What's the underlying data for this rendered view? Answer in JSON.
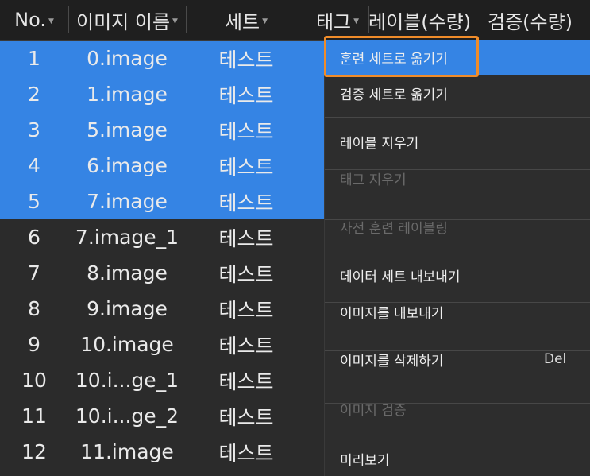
{
  "table": {
    "columns": [
      {
        "label": "No."
      },
      {
        "label": "이미지 이름"
      },
      {
        "label": "세트"
      },
      {
        "label": "태그"
      },
      {
        "label": "레이블(수량)"
      },
      {
        "label": "검증(수량)"
      }
    ],
    "rows": [
      {
        "no": "1",
        "name": "0.image",
        "set": "테스트",
        "selected": true
      },
      {
        "no": "2",
        "name": "1.image",
        "set": "테스트",
        "selected": true
      },
      {
        "no": "3",
        "name": "5.image",
        "set": "테스트",
        "selected": true
      },
      {
        "no": "4",
        "name": "6.image",
        "set": "테스트",
        "selected": true
      },
      {
        "no": "5",
        "name": "7.image",
        "set": "테스트",
        "selected": true
      },
      {
        "no": "6",
        "name": "7.image_1",
        "set": "테스트",
        "selected": false
      },
      {
        "no": "7",
        "name": "8.image",
        "set": "테스트",
        "selected": false
      },
      {
        "no": "8",
        "name": "9.image",
        "set": "테스트",
        "selected": false
      },
      {
        "no": "9",
        "name": "10.image",
        "set": "테스트",
        "selected": false
      },
      {
        "no": "10",
        "name": "10.i...ge_1",
        "set": "테스트",
        "selected": false
      },
      {
        "no": "11",
        "name": "10.i...ge_2",
        "set": "테스트",
        "selected": false
      },
      {
        "no": "12",
        "name": "11.image",
        "set": "테스트",
        "selected": false
      }
    ]
  },
  "context_menu": {
    "items": [
      {
        "label": "훈련 세트로 옮기기",
        "highlighted": true
      },
      {
        "label": "검증 세트로 옮기기"
      },
      {
        "label": "레이블 지우기"
      },
      {
        "label": "태그 지우기",
        "disabled": true
      },
      {
        "label": "사전 훈련 레이블링",
        "disabled": true
      },
      {
        "label": "데이터 세트 내보내기"
      },
      {
        "label": "이미지를 내보내기"
      },
      {
        "label": "이미지를 삭제하기",
        "shortcut": "Del"
      },
      {
        "label": "이미지 검증",
        "disabled": true
      },
      {
        "label": "미리보기"
      }
    ]
  },
  "colors": {
    "selection": "#3584e4",
    "focus_ring": "#f08c2a",
    "background": "#2b2b2b",
    "header_bg": "#1f1f1f"
  }
}
